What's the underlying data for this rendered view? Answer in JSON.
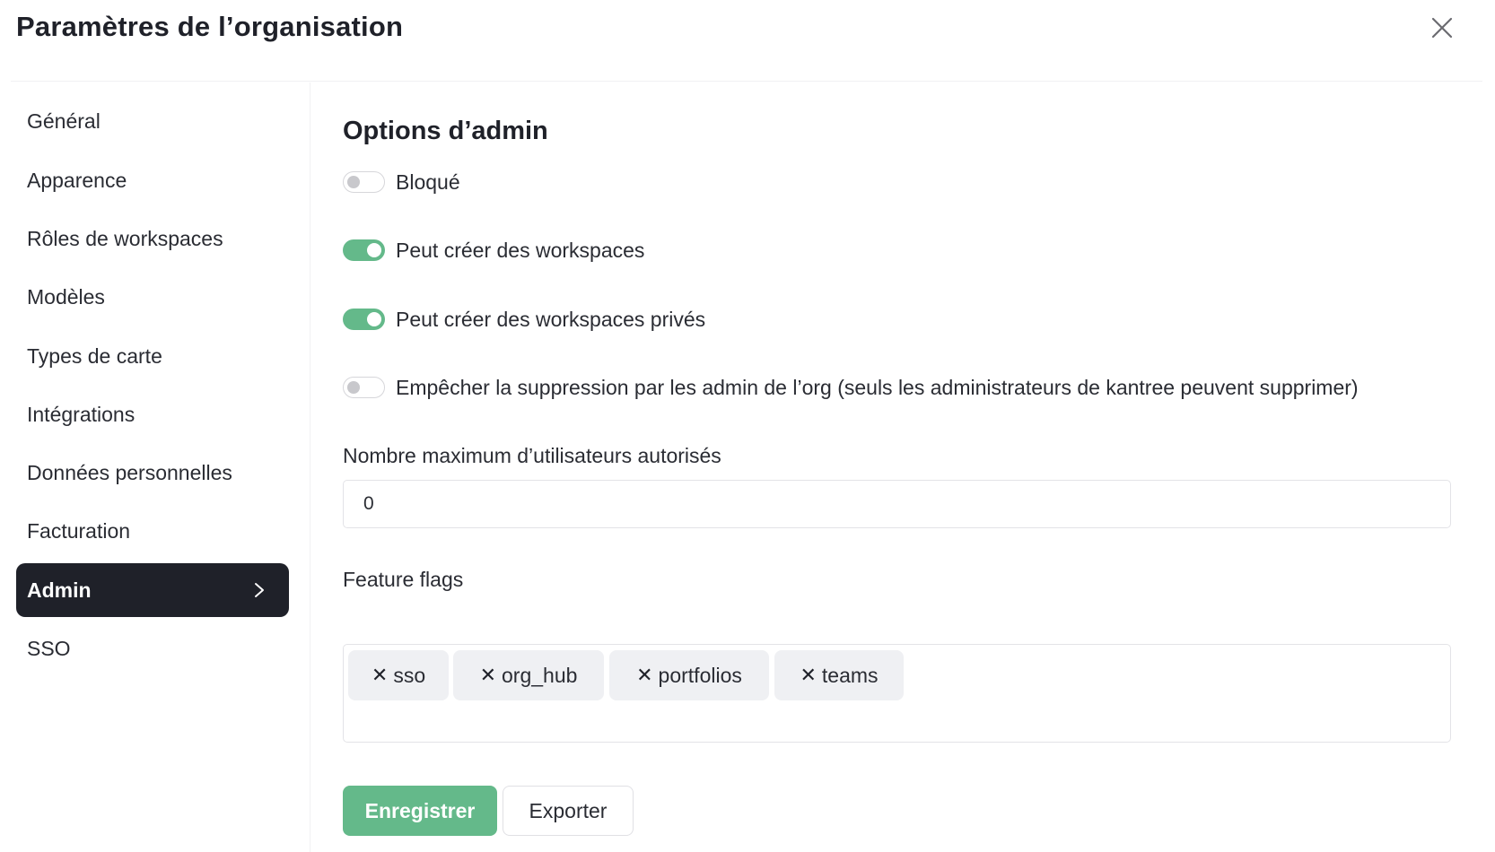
{
  "window": {
    "title": "Paramètres de l’organisation",
    "close_icon": "close-icon"
  },
  "sidebar": {
    "items": [
      {
        "label": "Général",
        "active": false
      },
      {
        "label": "Apparence",
        "active": false
      },
      {
        "label": "Rôles de workspaces",
        "active": false
      },
      {
        "label": "Modèles",
        "active": false
      },
      {
        "label": "Types de carte",
        "active": false
      },
      {
        "label": "Intégrations",
        "active": false
      },
      {
        "label": "Données personnelles",
        "active": false
      },
      {
        "label": "Facturation",
        "active": false
      },
      {
        "label": "Admin",
        "active": true,
        "icon": "chevron-right-icon"
      },
      {
        "label": "SSO",
        "active": false
      }
    ]
  },
  "main": {
    "section_title": "Options d’admin",
    "toggles": [
      {
        "label": "Bloqué",
        "checked": false
      },
      {
        "label": "Peut créer des workspaces",
        "checked": true
      },
      {
        "label": "Peut créer des workspaces privés",
        "checked": true
      },
      {
        "label": "Empêcher la suppression par les admin de l’org (seuls les administrateurs de kantree peuvent supprimer)",
        "checked": false
      }
    ],
    "max_users": {
      "label": "Nombre maximum d’utilisateurs autorisés",
      "value": "0"
    },
    "feature_flags": {
      "label": "Feature flags",
      "remove_glyph": "✕",
      "tags": [
        "sso",
        "org_hub",
        "portfolios",
        "teams"
      ]
    },
    "buttons": {
      "save": "Enregistrer",
      "export": "Exporter"
    }
  },
  "colors": {
    "accent": "#64b98a",
    "active_nav_bg": "#1f2129",
    "tag_bg": "#eff0f3"
  }
}
